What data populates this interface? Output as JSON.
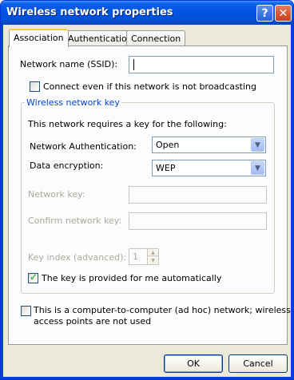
{
  "window": {
    "title": "Wireless network properties",
    "help_glyph": "?",
    "close_glyph": "✕"
  },
  "tabs": [
    {
      "label": "Association",
      "active": true
    },
    {
      "label": "Authentication",
      "active": false
    },
    {
      "label": "Connection",
      "active": false
    }
  ],
  "association": {
    "ssid_label": "Network name (SSID):",
    "ssid_value": "",
    "connect_hidden_label": "Connect even if this network is not broadcasting",
    "connect_hidden_checked": false,
    "key_group_title": "Wireless network key",
    "key_required_text": "This network requires a key for the following:",
    "auth_label": "Network Authentication:",
    "auth_value": "Open",
    "encryption_label": "Data encryption:",
    "encryption_value": "WEP",
    "network_key_label": "Network key:",
    "network_key_value": "",
    "confirm_key_label": "Confirm network key:",
    "confirm_key_value": "",
    "key_index_label": "Key index (advanced):",
    "key_index_value": "1",
    "auto_key_label": "The key is provided for me automatically",
    "auto_key_checked": true,
    "adhoc_label_line1": "This is a computer-to-computer (ad hoc) network; wireless",
    "adhoc_label_line2": "access points are not used",
    "adhoc_checked": false
  },
  "buttons": {
    "ok": "OK",
    "cancel": "Cancel"
  },
  "icons": {
    "dropdown_arrow": "chevron-down-icon",
    "checkmark": "checkmark-icon"
  },
  "colors": {
    "titlebar": "#0054e3",
    "dialog_bg": "#ece9d8",
    "group_title": "#0046d5",
    "disabled_text": "#aca899"
  }
}
